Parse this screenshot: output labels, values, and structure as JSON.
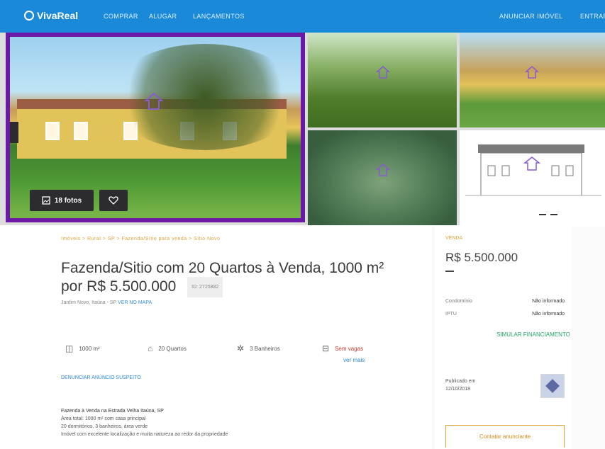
{
  "header": {
    "logo_text": "VivaReal",
    "nav": [
      "COMPRAR",
      "ALUGAR",
      "LANÇAMENTOS"
    ],
    "right_links": [
      "ANUNCIAR IMÓVEL",
      "ENTRAR"
    ]
  },
  "gallery": {
    "photos_button": "18 fotos"
  },
  "breadcrumb": "Imóveis > Rural > SP > Fazenda/Sítio para venda > Sítio Novo",
  "listing": {
    "title": "Fazenda/Sitio com 20 Quartos à Venda, 1000 m² por R$ 5.500.000",
    "code": "ID: 2725882",
    "address_prefix": "Jardim Novo, Itaúna - SP",
    "address_link": "VER NO MAPA",
    "features": {
      "area": "1000 m²",
      "bedrooms": "20 Quartos",
      "bathrooms": "3 Banheiros",
      "parking": "Sem vagas",
      "parking_sub": "ver mais"
    },
    "report_link": "DENUNCIAR ANÚNCIO SUSPEITO",
    "description": [
      "Fazenda à Venda na Estrada Velha Itaúna, SP",
      "Área total: 1000 m² com casa principal",
      "20 dormitórios, 3 banheiros, área verde",
      "Imóvel com excelente localização e muita natureza ao redor da propriedade"
    ]
  },
  "sidebar": {
    "price_label": "VENDA",
    "price": "R$ 5.500.000",
    "rows": [
      {
        "label": "Condomínio",
        "value": "Não informado"
      },
      {
        "label": "IPTU",
        "value": "Não informado"
      }
    ],
    "simulate_link": "SIMULAR FINANCIAMENTO",
    "published_label": "Publicado em",
    "published_date": "12/10/2018",
    "contact_button": "Contatar anunciante"
  },
  "colors": {
    "header": "#1a8ad8",
    "photo_frame": "#6b1aa6",
    "accent_orange": "#e0a33b",
    "link_blue": "#2a86d0",
    "green": "#25a36d"
  }
}
